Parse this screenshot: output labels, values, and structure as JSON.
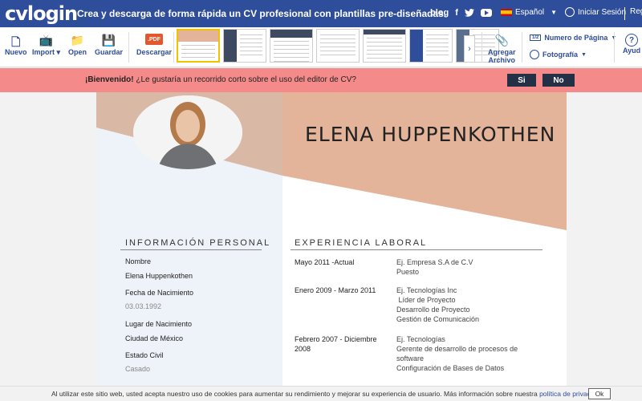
{
  "header": {
    "logo": "cvlogin",
    "tagline": "Crea y descarga de forma rápida un CV profesional con plantillas pre-diseñadas.",
    "blog": "blog",
    "language": "Español",
    "login": "Iniciar Sesión",
    "register": "Regi"
  },
  "toolbar": {
    "new": "Nuevo",
    "import": "Import",
    "open": "Open",
    "save": "Guardar",
    "pdf_icon": ".PDF",
    "download": "Descargar",
    "add_file_line1": "Agregar",
    "add_file_line2": "Archivo",
    "page_number": "Numero de Página",
    "photo": "Fotografía",
    "help": "Ayud"
  },
  "welcome": {
    "greeting": "¡Bienvenido!",
    "question": " ¿Le gustaría un recorrido corto sobre el uso del editor de CV?",
    "yes": "Si",
    "no": "No"
  },
  "cv": {
    "name": "ELENA HUPPENKOTHEN",
    "personal_title": "INFORMACIÓN PERSONAL",
    "personal": [
      {
        "label": "Nombre",
        "value": "Elena Huppenkothen"
      },
      {
        "label": "Fecha de Nacimiento",
        "value": "03.03.1992"
      },
      {
        "label": "Lugar de Nacimiento",
        "value": "Ciudad de México"
      },
      {
        "label": "Estado Civil",
        "value": "Casado"
      }
    ],
    "experience_title": "EXPERIENCIA LABORAL",
    "experience": [
      {
        "date1": "Mayo 2011 -Actual",
        "date2": "",
        "lines": [
          "Ej. Empresa S.A de C.V",
          "Puesto"
        ]
      },
      {
        "date1": "Enero 2009 - Marzo 2011",
        "date2": "",
        "lines": [
          "Ej. Tecnologías Inc",
          " Líder de Proyecto",
          "Desarrollo de Proyecto",
          "Gestión de Comunicación"
        ]
      },
      {
        "date1": "Febrero 2007 - Diciembre",
        "date2": "2008",
        "lines": [
          "Ej. Tecnologías",
          "Gerente de desarrollo de procesos de",
          "software",
          "Configuración de Bases de Datos"
        ]
      }
    ]
  },
  "cookie": {
    "text": "Al utilizar este sitio web, usted acepta nuestro uso de cookies para aumentar su rendimiento y mejorar su experiencia de usuario. Más información sobre nuestra ",
    "link": "política de privacidad",
    "ok": "Ok"
  },
  "colors": {
    "brand_blue": "#2e4d9a",
    "welcome_bar": "#f58a8a",
    "peach": "#e3b49a",
    "dark_button": "#233046"
  }
}
